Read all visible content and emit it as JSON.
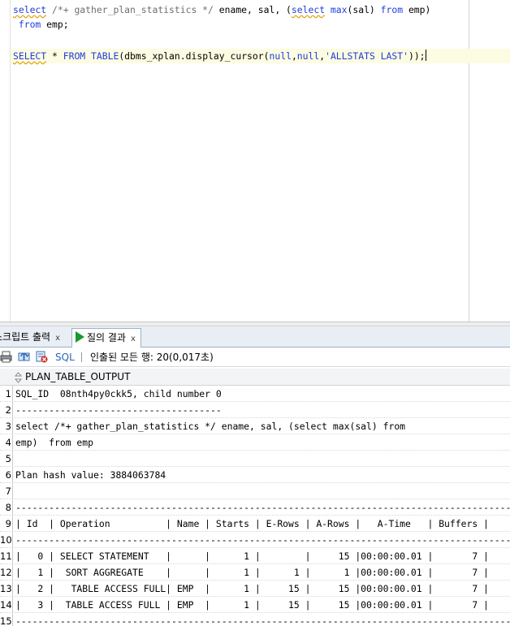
{
  "editor": {
    "lines": [
      "select /*+ gather_plan_statistics */ ename, sal, (select max(sal) from emp)",
      " from emp;",
      "",
      "SELECT * FROM TABLE(dbms_xplan.display_cursor(null,null,'ALLSTATS LAST'));"
    ]
  },
  "tabs": [
    {
      "label": "스크립트 출력",
      "close": "x"
    },
    {
      "label": "질의 결과",
      "close": "x"
    }
  ],
  "toolbar": {
    "sql_label": "SQL",
    "status": "인출된 모든 행: 20(0,017초)"
  },
  "grid": {
    "column": "PLAN_TABLE_OUTPUT",
    "rows": [
      {
        "n": "1",
        "text": "SQL_ID  08nth4py0ckk5, child number 0"
      },
      {
        "n": "2",
        "text": "-------------------------------------"
      },
      {
        "n": "3",
        "text": "select /*+ gather_plan_statistics */ ename, sal, (select max(sal) from"
      },
      {
        "n": "4",
        "text": "emp)  from emp"
      },
      {
        "n": "5",
        "text": ""
      },
      {
        "n": "6",
        "text": "Plan hash value: 3884063784"
      },
      {
        "n": "7",
        "text": ""
      },
      {
        "n": "8",
        "text": "-----------------------------------------------------------------------------------------"
      },
      {
        "n": "9",
        "text": "| Id  | Operation          | Name | Starts | E-Rows | A-Rows |   A-Time   | Buffers |"
      },
      {
        "n": "10",
        "text": "-----------------------------------------------------------------------------------------"
      },
      {
        "n": "11",
        "text": "|   0 | SELECT STATEMENT   |      |      1 |        |     15 |00:00:00.01 |       7 |"
      },
      {
        "n": "12",
        "text": "|   1 |  SORT AGGREGATE    |      |      1 |      1 |      1 |00:00:00.01 |       7 |"
      },
      {
        "n": "13",
        "text": "|   2 |   TABLE ACCESS FULL| EMP  |      1 |     15 |     15 |00:00:00.01 |       7 |"
      },
      {
        "n": "14",
        "text": "|   3 |  TABLE ACCESS FULL | EMP  |      1 |     15 |     15 |00:00:00.01 |       7 |"
      },
      {
        "n": "15",
        "text": "-----------------------------------------------------------------------------------------"
      }
    ]
  }
}
